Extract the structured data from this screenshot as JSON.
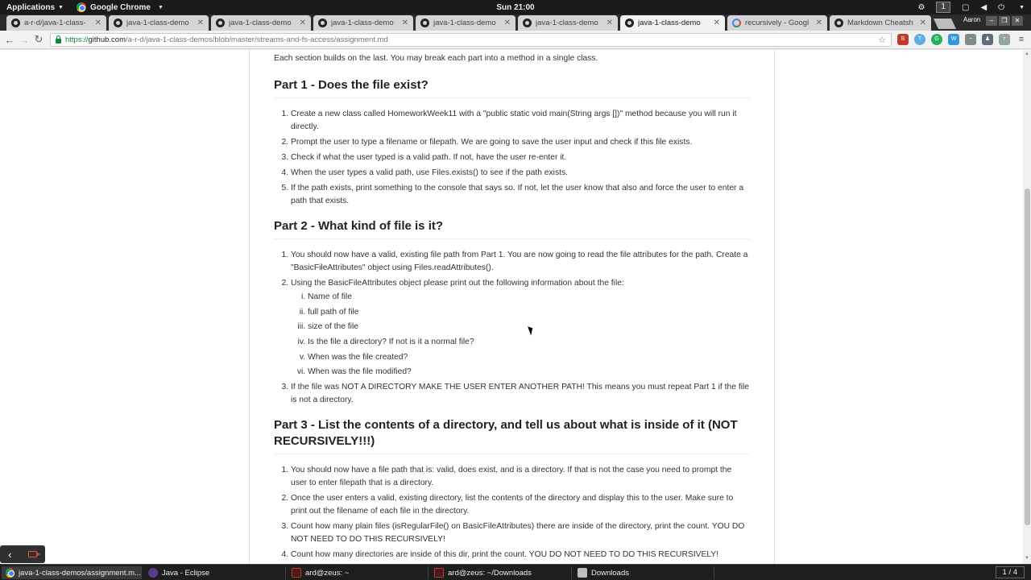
{
  "topbar": {
    "applications": "Applications",
    "active_app": "Google Chrome",
    "clock": "Sun 21:00",
    "workspace": "1"
  },
  "tabs": [
    {
      "title": "a-r-d/java-1-class-",
      "icon": "github-icon"
    },
    {
      "title": "java-1-class-demo",
      "icon": "github-icon"
    },
    {
      "title": "java-1-class-demo",
      "icon": "github-icon"
    },
    {
      "title": "java-1-class-demo",
      "icon": "github-icon"
    },
    {
      "title": "java-1-class-demo",
      "icon": "github-icon"
    },
    {
      "title": "java-1-class-demo",
      "icon": "github-icon"
    },
    {
      "title": "java-1-class-demo",
      "icon": "github-icon",
      "active": true
    },
    {
      "title": "recursively - Googl",
      "icon": "google-icon"
    },
    {
      "title": "Markdown Cheatsh",
      "icon": "github-icon"
    }
  ],
  "profile_name": "Aaron",
  "address_bar": {
    "scheme": "https://",
    "host": "github.com",
    "path": "/a-r-d/java-1-class-demos/blob/master/streams-and-fs-access/assignment.md"
  },
  "article": {
    "intro": "Each section builds on the last. You may break each part into a method in a single class.",
    "part1": {
      "heading": "Part 1 - Does the file exist?",
      "steps": [
        "Create a new class called HomeworkWeek11 with a \"public static void main(String args [])\" method because you will run it directly.",
        "Prompt the user to type a filename or filepath. We are going to save the user input and check if this file exists.",
        "Check if what the user typed is a valid path. If not, have the user re-enter it.",
        "When the user types a valid path, use Files.exists() to see if the path exists.",
        "If the path exists, print something to the console that says so. If not, let the user know that also and force the user to enter a path that exists."
      ]
    },
    "part2": {
      "heading": "Part 2 - What kind of file is it?",
      "step1": "You should now have a valid, existing file path from Part 1. You are now going to read the file attributes for the path. Create a \"BasicFileAttributes\" object using Files.readAttributes().",
      "step2": "Using the BasicFileAttributes object please print out the following information about the file:",
      "subitems": [
        "Name of file",
        "full path of file",
        "size of the file",
        "Is the file a directory? If not is it a normal file?",
        "When was the file created?",
        "When was the file modified?"
      ],
      "step3": "If the file was NOT A DIRECTORY MAKE THE USER ENTER ANOTHER PATH! This means you must repeat Part 1 if the file is not a directory."
    },
    "part3": {
      "heading": "Part 3 - List the contents of a directory, and tell us about what is inside of it (NOT RECURSIVELY!!!)",
      "steps": [
        "You should now have a file path that is: valid, does exist, and is a directory. If that is not the case you need to prompt the user to enter filepath that is a directory.",
        "Once the user enters a valid, existing directory, list the contents of the directory and display this to the user. Make sure to print out the filename of each file in the directory.",
        "Count how many plain files (isRegularFile() on BasicFileAttributes) there are inside of the directory, print the count. YOU DO NOT NEED TO DO THIS RECURSIVELY!",
        "Count how many directories are inside of this dir, print the count. YOU DO NOT NEED TO DO THIS RECURSIVELY!"
      ]
    }
  },
  "taskbar": {
    "items": [
      {
        "label": "java-1-class-demos/assignment.m...",
        "icon": "chrome-icon",
        "active": true
      },
      {
        "label": "Java - Eclipse",
        "icon": "eclipse-icon"
      },
      {
        "label": "ard@zeus: ~",
        "icon": "terminal-icon"
      },
      {
        "label": "ard@zeus: ~/Downloads",
        "icon": "terminal-icon"
      },
      {
        "label": "Downloads",
        "icon": "folder-icon"
      }
    ],
    "pager": "1 / 4"
  },
  "colors": {
    "link_green": "#0a8a3a",
    "text": "#333333",
    "heading": "#222222"
  }
}
